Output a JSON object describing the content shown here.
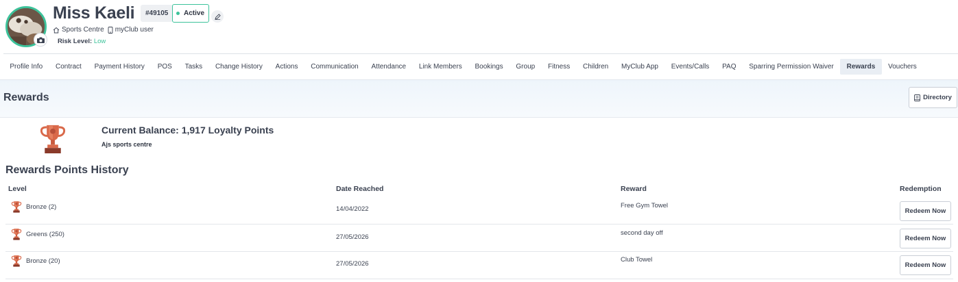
{
  "profile": {
    "name": "Miss Kaeli",
    "member_id": "#49105",
    "status": "Active",
    "location": "Sports Centre",
    "app_user": "myClub user",
    "risk_label": "Risk Level:",
    "risk_value": "Low",
    "colors": {
      "active": "#3cc29a",
      "risk_low": "#3cc29a"
    },
    "icons": [
      "camera-icon",
      "edit-icon",
      "home-icon",
      "phone-icon"
    ]
  },
  "tabs": [
    {
      "label": "Profile Info"
    },
    {
      "label": "Contract"
    },
    {
      "label": "Payment History"
    },
    {
      "label": "POS"
    },
    {
      "label": "Tasks"
    },
    {
      "label": "Change History"
    },
    {
      "label": "Actions"
    },
    {
      "label": "Communication"
    },
    {
      "label": "Attendance"
    },
    {
      "label": "Link Members"
    },
    {
      "label": "Bookings"
    },
    {
      "label": "Group"
    },
    {
      "label": "Fitness"
    },
    {
      "label": "Children"
    },
    {
      "label": "MyClub App"
    },
    {
      "label": "Events/Calls"
    },
    {
      "label": "PAQ"
    },
    {
      "label": "Sparring Permission Waiver"
    },
    {
      "label": "Rewards",
      "active": true
    },
    {
      "label": "Vouchers"
    }
  ],
  "section": {
    "title": "Rewards",
    "directory_label": "Directory"
  },
  "balance": {
    "text": "Current Balance: 1,917 Loyalty Points",
    "club": "Ajs sports centre"
  },
  "history": {
    "title": "Rewards Points History",
    "columns": {
      "level": "Level",
      "date": "Date Reached",
      "reward": "Reward",
      "redemption": "Redemption"
    },
    "rows": [
      {
        "level": "Bronze (2)",
        "date": "14/04/2022",
        "reward": "Free Gym Towel",
        "action": "Redeem Now"
      },
      {
        "level": "Greens (250)",
        "date": "27/05/2026",
        "reward": "second day off",
        "action": "Redeem Now"
      },
      {
        "level": "Bronze (20)",
        "date": "27/05/2026",
        "reward": "Club Towel",
        "action": "Redeem Now"
      }
    ]
  },
  "colors": {
    "accent": "#3cc29a",
    "text": "#3a4150",
    "trophy": "#d9694a",
    "tab_active_bg": "#e9eef4"
  }
}
